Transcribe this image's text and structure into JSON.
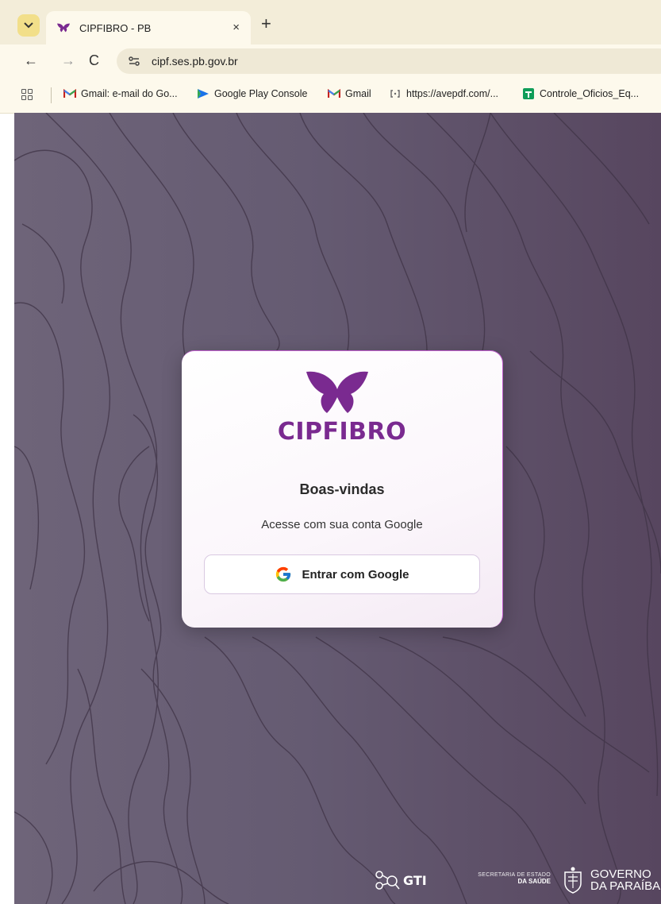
{
  "browser": {
    "tab_title": "CIPFIBRO - PB",
    "tab_close": "×",
    "new_tab": "+",
    "url": "cipf.ses.pb.gov.br",
    "nav": {
      "back": "←",
      "forward": "→",
      "reload": "C"
    },
    "bookmarks": [
      {
        "label": "Gmail: e-mail do Go...",
        "icon": "gmail-icon"
      },
      {
        "label": "Google Play Console",
        "icon": "play-console-icon"
      },
      {
        "label": "Gmail",
        "icon": "gmail-icon"
      },
      {
        "label": "https://avepdf.com/...",
        "icon": "link-icon"
      },
      {
        "label": "Controle_Oficios_Eq...",
        "icon": "sheets-icon"
      }
    ]
  },
  "card": {
    "brand": "CIPFIBRO",
    "welcome": "Boas-vindas",
    "subtitle": "Acesse com sua conta Google",
    "google_button": "Entrar com Google"
  },
  "footer": {
    "gti": "GTI",
    "ses_line1": "SECRETARIA DE ESTADO",
    "ses_line2": "DA SAÚDE",
    "gov_line1": "GOVERNO",
    "gov_line2": "DA PARAÍBA"
  },
  "colors": {
    "brand_purple": "#7a2a90",
    "page_bg": "#655b72",
    "card_accent": "#c25fcf"
  }
}
